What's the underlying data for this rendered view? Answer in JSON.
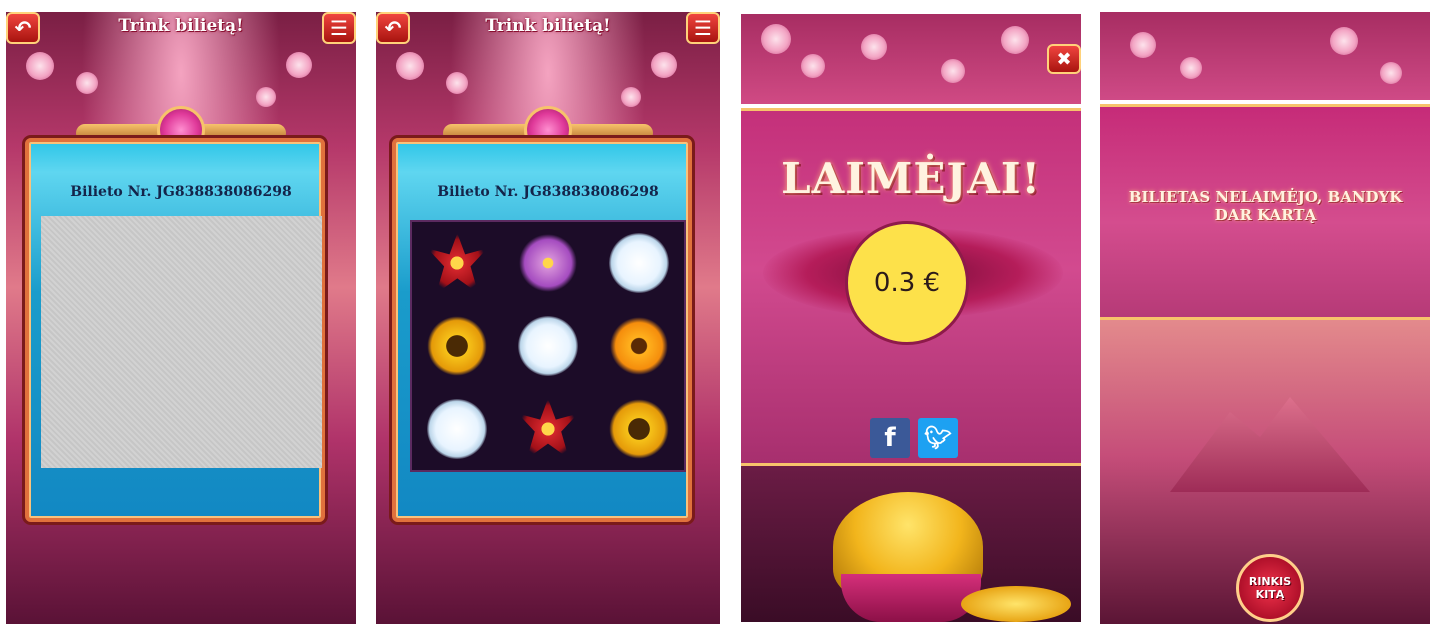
{
  "colors": {
    "accent": "#d24a8f",
    "gold": "#f7c36b",
    "button_red": "#d2252b",
    "prize_yellow": "#fde14a"
  },
  "screen1": {
    "back_icon": "back-arrow-icon",
    "menu_icon": "hamburger-menu-icon",
    "title": "Trink bilietą!",
    "ticket_number": "Bilieto Nr. JG838838086298"
  },
  "screen2": {
    "back_icon": "back-arrow-icon",
    "menu_icon": "hamburger-menu-icon",
    "title": "Trink bilietą!",
    "ticket_number": "Bilieto Nr. JG838838086298",
    "symbols": [
      "red-flower",
      "pink-flower",
      "white-flower",
      "sunflower",
      "white-flower",
      "orange-flower",
      "white-flower",
      "red-flower",
      "sunflower"
    ]
  },
  "screen3": {
    "close_icon": "close-icon",
    "heading": "LAIMĖJAI!",
    "prize": "0.3 €",
    "facebook_label": "f",
    "twitter_icon": "twitter-bird-icon"
  },
  "screen4": {
    "message": "BILIETAS NELAIMĖJO, BANDYK DAR KARTĄ",
    "button_label": "RINKIS KITĄ"
  }
}
